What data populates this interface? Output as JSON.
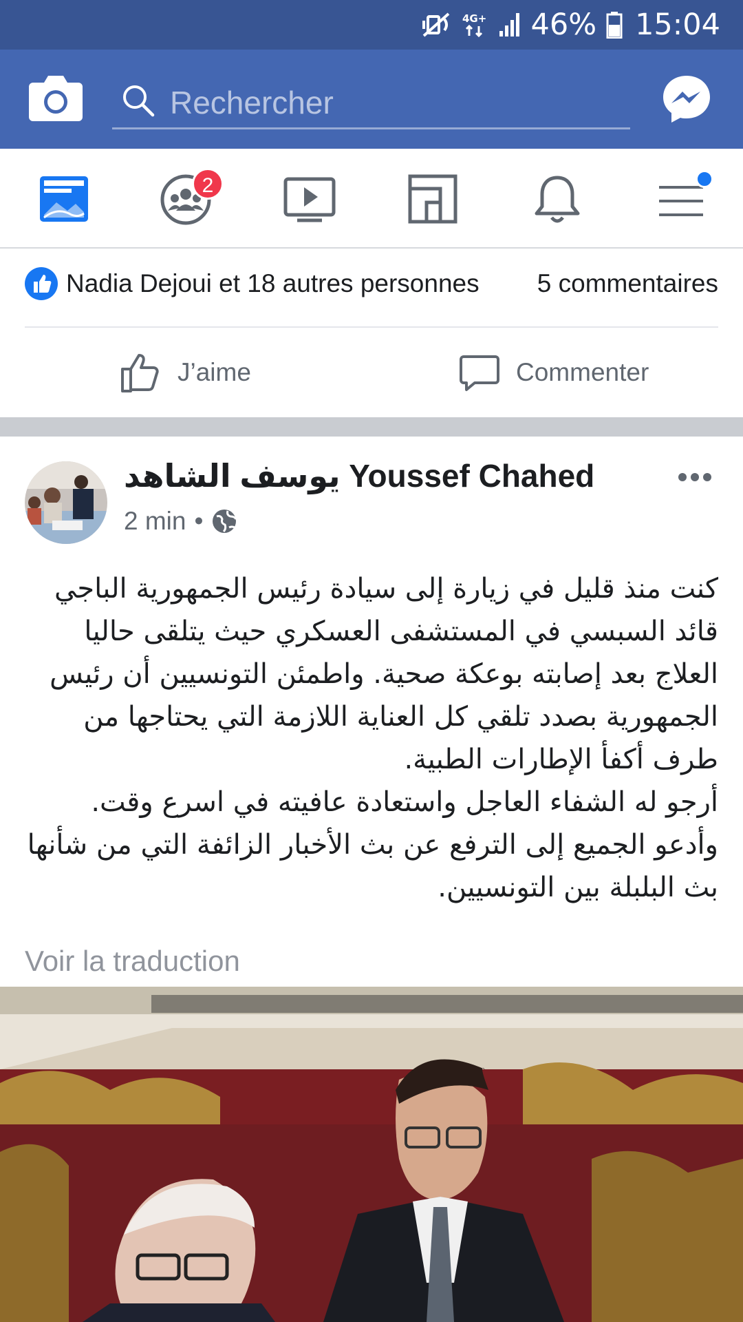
{
  "status_bar": {
    "network": "4G+",
    "battery": "46%",
    "time": "15:04"
  },
  "app_bar": {
    "search_placeholder": "Rechercher"
  },
  "nav": {
    "friends_badge": "2"
  },
  "reactions": {
    "likers": "Nadia Dejoui et 18 autres personnes",
    "comments": "5 commentaires"
  },
  "actions": {
    "like": "J’aime",
    "comment": "Commenter"
  },
  "post": {
    "author": "يوسف الشاهد Youssef Chahed",
    "time": "2 min",
    "separator": "•",
    "body": [
      "كنت منذ قليل في زيارة إلى سيادة رئيس الجمهورية الباجي قائد السبسي في المستشفى العسكري حيث يتلقى حاليا العلاج بعد إصابته بوعكة صحية. واطمئن التونسيين أن رئيس الجمهورية بصدد تلقي كل العناية اللازمة التي يحتاجها من طرف أكفأ الإطارات الطبية.",
      "أرجو له الشفاء العاجل واستعادة عافيته في اسرع وقت.",
      "وأدعو الجميع إلى الترفع عن بث الأخبار الزائفة التي من شأنها بث البلبلة بين التونسيين."
    ],
    "translate": "Voir la traduction"
  },
  "colors": {
    "brand_blue": "#4467b2",
    "status_blue": "#385593",
    "badge_red": "#f0374b",
    "link_blue": "#1877f2"
  },
  "icons": [
    "mute-icon",
    "signal-icon",
    "battery-icon",
    "camera-icon",
    "search-icon",
    "messenger-icon",
    "news-feed-icon",
    "groups-icon",
    "watch-icon",
    "marketplace-icon",
    "bell-icon",
    "menu-icon",
    "like-icon",
    "comment-icon",
    "globe-icon",
    "more-icon"
  ]
}
